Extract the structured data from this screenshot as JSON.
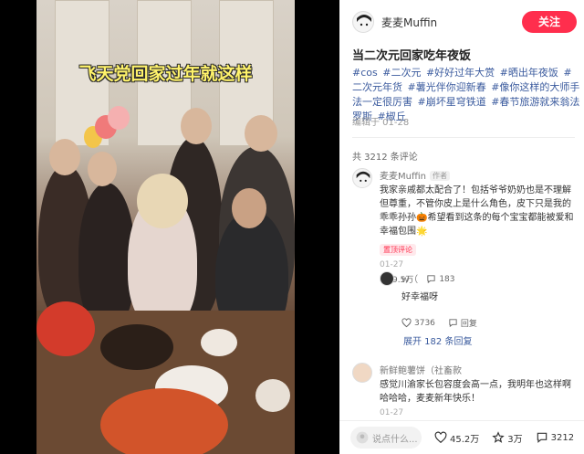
{
  "media": {
    "caption": "飞天党回家过年就这样"
  },
  "author": {
    "name": "麦麦Muffin",
    "follow_label": "关注"
  },
  "post": {
    "title": "当二次元回家吃年夜饭",
    "tags": [
      "#cos",
      "#二次元",
      "#好好过年大赏",
      "#晒出年夜饭",
      "#二次元年货",
      "#薯光伴你迎新春",
      "#像你这样的大师手法一定很厉害",
      "#崩坏星穹铁道",
      "#春节旅游就来翁法罗斯",
      "#椒丘"
    ],
    "edited": "编辑于 01-28"
  },
  "comments_summary": {
    "count_text": "共 3212 条评论"
  },
  "comments": [
    {
      "name": "麦麦Muffin",
      "badge": "作者",
      "text": "我家亲戚都太配合了！包括爷爷奶奶也是不理解但尊重，不管你皮上是什么角色，皮下只是我的乖乖孙孙🎃希望看到这条的每个宝宝都能被爱和幸福包围🌟",
      "pinned": "置顶评论",
      "date": "01-27",
      "likes": "9.5万",
      "replies": "183"
    },
    {
      "name": "w（",
      "text": "好幸福呀",
      "likes": "3736",
      "reply_label": "回复",
      "expand": "展开 182 条回复"
    },
    {
      "name": "新鲜鲍薯饼（社畜款",
      "text": "感觉川渝家长包容度会高一点，我明年也这样啊哈哈哈，麦麦新年快乐！",
      "date": "01-27"
    }
  ],
  "bottom_bar": {
    "input_placeholder": "说点什么...",
    "likes": "45.2万",
    "favorites": "3万",
    "comments": "3212"
  },
  "colors": {
    "brand_red": "#ff2e4d",
    "tag_blue": "#3b5b9e",
    "caption_yellow": "#fff36b"
  }
}
